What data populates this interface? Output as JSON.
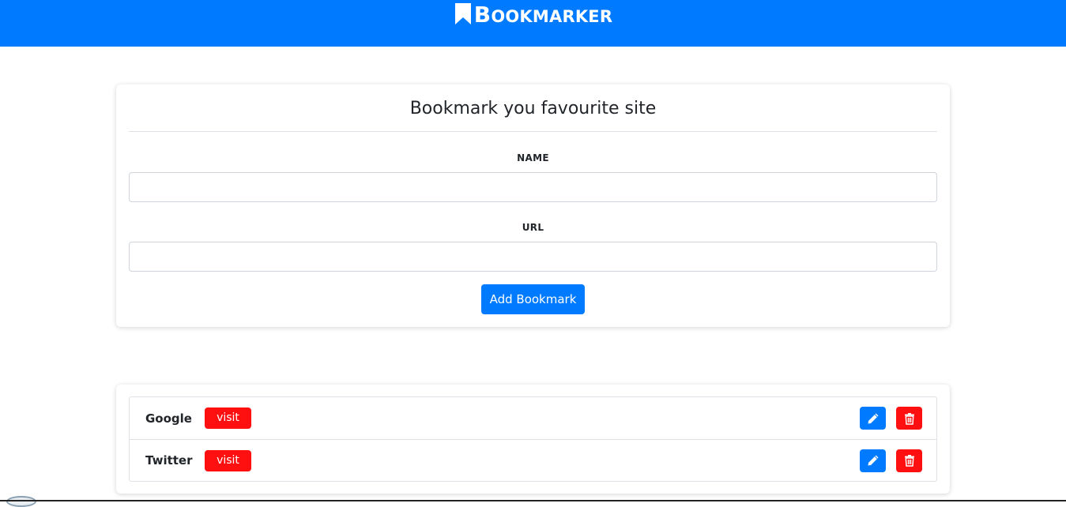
{
  "navbar": {
    "brand_first": "B",
    "brand_rest": "OOKMARKER",
    "brand_icon": "bookmark-icon",
    "color": "#007bff"
  },
  "form": {
    "title": "Bookmark you favourite site",
    "name_label": "NAME",
    "name_value": "",
    "url_label": "URL",
    "url_value": "",
    "submit_label": "Add Bookmark"
  },
  "bookmarks": [
    {
      "name": "Google",
      "visit_label": "visit",
      "edit_icon": "pencil-icon",
      "delete_icon": "trash-icon"
    },
    {
      "name": "Twitter",
      "visit_label": "visit",
      "edit_icon": "pencil-icon",
      "delete_icon": "trash-icon"
    }
  ],
  "colors": {
    "primary": "#007bff",
    "danger": "#ff1010"
  }
}
